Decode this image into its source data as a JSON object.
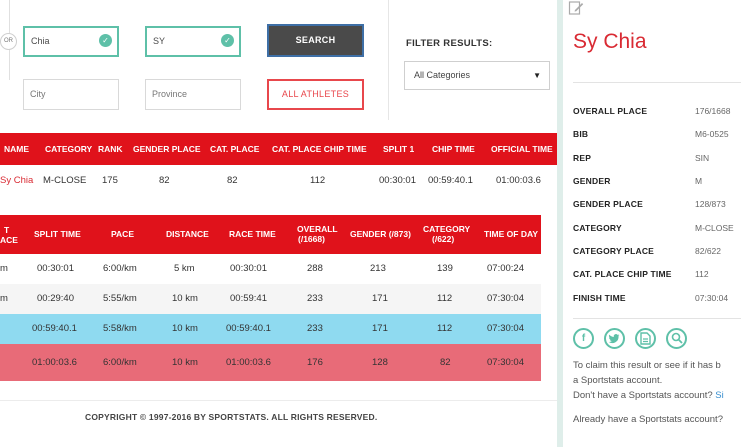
{
  "search": {
    "or_label": "OR",
    "first_name_value": "Chia",
    "last_name_value": "SY",
    "city_placeholder": "City",
    "province_placeholder": "Province",
    "search_button": "SEARCH",
    "all_athletes_button": "ALL ATHLETES"
  },
  "filter": {
    "label": "FILTER RESULTS:",
    "selected": "All Categories"
  },
  "results_table": {
    "headers": [
      "NAME",
      "CATEGORY",
      "RANK",
      "GENDER PLACE",
      "CAT. PLACE",
      "CAT. PLACE CHIP TIME",
      "SPLIT 1",
      "CHIP TIME",
      "OFFICIAL TIME"
    ],
    "row": [
      "Sy Chia",
      "M-CLOSE",
      "175",
      "82",
      "82",
      "112",
      "00:30:01",
      "00:59:40.1",
      "01:00:03.6"
    ]
  },
  "splits_table": {
    "headers": [
      "T",
      "ACE",
      "SPLIT TIME",
      "PACE",
      "DISTANCE",
      "RACE TIME",
      "OVERALL",
      "(/1668)",
      "GENDER (/873)",
      "CATEGORY",
      "(/622)",
      "TIME OF DAY"
    ],
    "rows": [
      {
        "cells": [
          "m",
          "00:30:01",
          "6:00/km",
          "5 km",
          "00:30:01",
          "288",
          "213",
          "139",
          "07:00:24"
        ],
        "bg": "#ffffff"
      },
      {
        "cells": [
          "m",
          "00:29:40",
          "5:55/km",
          "10 km",
          "00:59:41",
          "233",
          "171",
          "112",
          "07:30:04"
        ],
        "bg": "#f5f5f5"
      },
      {
        "cells": [
          "",
          "00:59:40.1",
          "5:58/km",
          "10 km",
          "00:59:40.1",
          "233",
          "171",
          "112",
          "07:30:04"
        ],
        "bg": "#8fdaf0"
      },
      {
        "cells": [
          "",
          "01:00:03.6",
          "6:00/km",
          "10 km",
          "01:00:03.6",
          "176",
          "128",
          "82",
          "07:30:04"
        ],
        "bg": "#e86b78"
      }
    ]
  },
  "footer": {
    "copyright": "COPYRIGHT © 1997-2016 BY SPORTSTATS. ALL RIGHTS RESERVED."
  },
  "sidebar": {
    "athlete_name": "Sy Chia",
    "details": [
      {
        "label": "OVERALL PLACE",
        "value": "176/1668"
      },
      {
        "label": "BIB",
        "value": "M6-0525"
      },
      {
        "label": "REP",
        "value": "SIN"
      },
      {
        "label": "GENDER",
        "value": "M"
      },
      {
        "label": "GENDER PLACE",
        "value": "128/873"
      },
      {
        "label": "CATEGORY",
        "value": "M-CLOSE"
      },
      {
        "label": "CATEGORY PLACE",
        "value": "82/622"
      },
      {
        "label": "CAT. PLACE CHIP TIME",
        "value": "112"
      },
      {
        "label": "FINISH TIME",
        "value": "07:30:04"
      }
    ],
    "social": [
      "f",
      "t",
      "doc",
      "search"
    ],
    "claim_line1": "To claim this result or see if it has b",
    "claim_line2": "a Sportstats account.",
    "claim_line3_text": "Don't have a Sportstats account? ",
    "claim_line3_link": "Si",
    "claim_line4": "Already have a Sportstats account?"
  },
  "colors": {
    "accent_red": "#e0121b",
    "teal": "#5ec0a8",
    "highlight_blue": "#8fdaf0",
    "highlight_pink": "#e86b78"
  }
}
